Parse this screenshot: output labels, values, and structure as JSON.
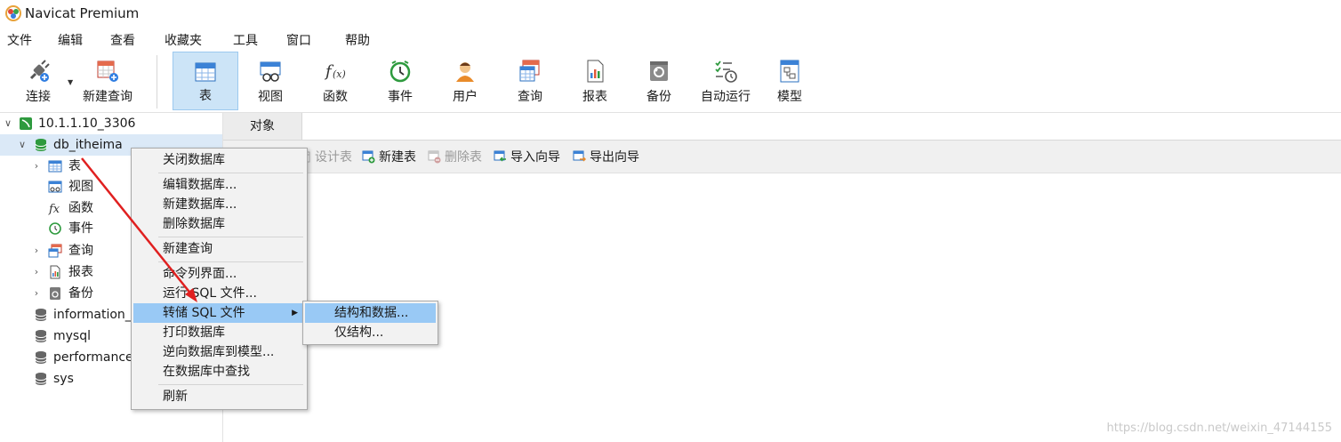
{
  "app": {
    "title": "Navicat Premium"
  },
  "menu": [
    "文件",
    "编辑",
    "查看",
    "收藏夹",
    "工具",
    "窗口",
    "帮助"
  ],
  "toolbar": {
    "connect": "连接",
    "new_query": "新建查询",
    "table": "表",
    "view": "视图",
    "function": "函数",
    "event": "事件",
    "user": "用户",
    "query": "查询",
    "report": "报表",
    "backup": "备份",
    "schedule": "自动运行",
    "model": "模型"
  },
  "tree": {
    "connection": "10.1.1.10_3306",
    "database": "db_itheima",
    "children": [
      "表",
      "视图",
      "函数",
      "事件",
      "查询",
      "报表",
      "备份"
    ],
    "other_dbs": [
      "information_",
      "mysql",
      "performance",
      "sys"
    ]
  },
  "tabs": {
    "objects": "对象"
  },
  "obj_toolbar": {
    "design": "设计表",
    "new": "新建表",
    "delete": "删除表",
    "import": "导入向导",
    "export": "导出向导"
  },
  "context_menu": {
    "close_db": "关闭数据库",
    "edit_db": "编辑数据库...",
    "new_db": "新建数据库...",
    "delete_db": "删除数据库",
    "new_query": "新建查询",
    "console": "命令列界面...",
    "run_sql": "运行 SQL 文件...",
    "dump_sql": "转储 SQL 文件",
    "print_db": "打印数据库",
    "reverse": "逆向数据库到模型...",
    "find": "在数据库中查找",
    "refresh": "刷新"
  },
  "submenu": {
    "structure_data": "结构和数据...",
    "structure_only": "仅结构..."
  },
  "watermark": "https://blog.csdn.net/weixin_47144155",
  "colors": {
    "accent": "#cce4f7",
    "highlight": "#99c9f5",
    "annotation": "#e02020"
  }
}
